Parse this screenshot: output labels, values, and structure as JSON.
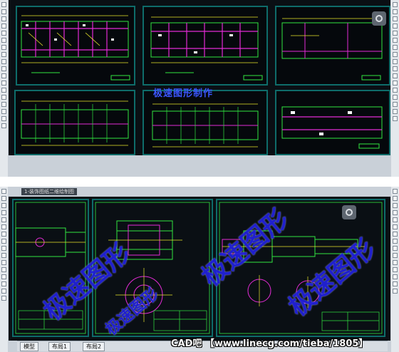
{
  "top_panel": {
    "watermark": "极速图形制作"
  },
  "bottom_panel": {
    "file_tab": "1-装饰图纸二维绘制图",
    "watermarks": [
      "极速图形",
      "极速图形",
      "极速图形",
      "极速图形"
    ],
    "layout_tabs": [
      "模型",
      "布局1",
      "布局2"
    ]
  },
  "footer": {
    "text": "CAD吧 【www.linecg.com/tieba/1805】"
  },
  "colors": {
    "canvas": "#05080c",
    "frame": "#0e6c6a",
    "watermark": "#2222dd",
    "linework_green": "#31e640",
    "linework_magenta": "#e42bd6",
    "linework_yellow": "#e8e62a"
  }
}
